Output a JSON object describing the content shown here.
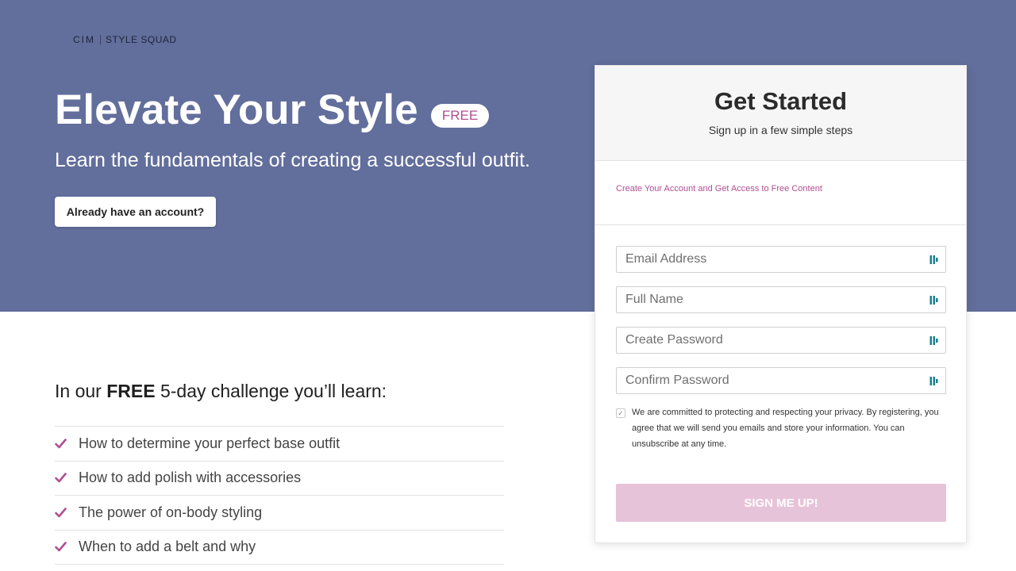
{
  "brand": {
    "mark": "CIM",
    "name": "STYLE SQUAD"
  },
  "hero": {
    "title": "Elevate Your Style",
    "badge": "FREE",
    "subtitle": "Learn the fundamentals of creating a successful outfit.",
    "login_label": "Already have an account?"
  },
  "learn": {
    "heading_prefix": "In our ",
    "heading_bold": "FREE",
    "heading_suffix": " 5-day challenge you’ll learn:",
    "items": [
      "How to determine your perfect base outfit",
      "How to add polish with accessories",
      "The power of on-body styling",
      "When to add a belt and why"
    ]
  },
  "signup": {
    "title": "Get Started",
    "subtitle": "Sign up in a few simple steps",
    "promo": "Create Your Account and Get Access to Free Content",
    "fields": {
      "email_placeholder": "Email Address",
      "name_placeholder": "Full Name",
      "password_placeholder": "Create Password",
      "confirm_placeholder": "Confirm Password"
    },
    "consent_checked": true,
    "consent_text": "We are committed to protecting and respecting your privacy. By registering, you agree that we will send you emails and store your information. You can unsubscribe at any time.",
    "submit_label": "SIGN ME UP!"
  },
  "colors": {
    "hero_bg": "#626e9b",
    "accent": "#b04f93",
    "submit_bg": "#e7c3d9",
    "field_icon": "#1a7f8e"
  },
  "icons": {
    "check": "check-icon",
    "field_autofill": "password-manager-icon"
  }
}
